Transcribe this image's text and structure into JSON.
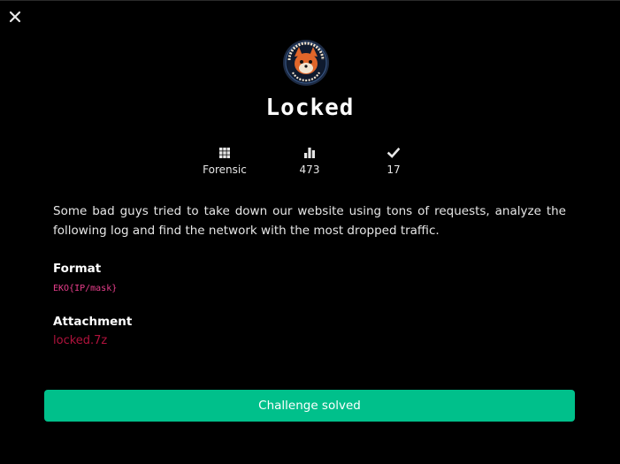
{
  "colors": {
    "background": "#000000",
    "text": "#e6e6e6",
    "accent_green": "#00c08b",
    "flag_format_pink": "#e83e8c",
    "attachment_red": "#b0123c"
  },
  "close_icon": "close-icon",
  "challenge": {
    "title": "Locked",
    "stats": [
      {
        "icon": "grid-icon",
        "value": "Forensic"
      },
      {
        "icon": "bar-chart-icon",
        "value": "473"
      },
      {
        "icon": "check-icon",
        "value": "17"
      }
    ],
    "description": "Some bad guys tried to take down our website using tons of requests, analyze the following log and find the network with the most dropped traffic.",
    "format_label": "Format",
    "format_value": "EKO{IP/mask}",
    "attachment_label": "Attachment",
    "attachment_file": "locked.7z",
    "solved_button": "Challenge solved"
  }
}
